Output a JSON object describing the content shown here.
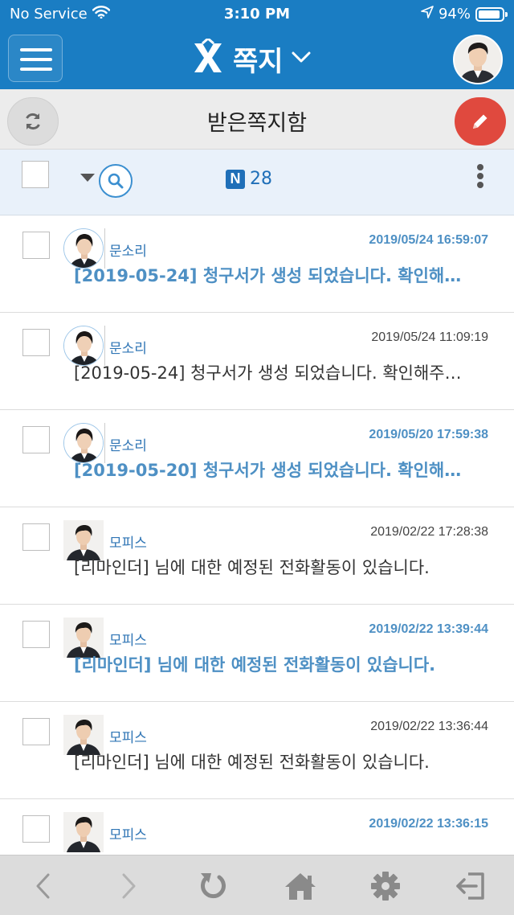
{
  "status_bar": {
    "carrier": "No Service",
    "time": "3:10 PM",
    "battery": "94%",
    "battery_level": 0.94
  },
  "header": {
    "title": "쪽지",
    "menu_icon": "hamburger-icon",
    "logo_icon": "app-logo-icon",
    "dropdown_icon": "chevron-down-icon",
    "profile_icon": "profile-avatar"
  },
  "subheader": {
    "title": "받은쪽지함",
    "refresh_icon": "refresh-icon",
    "compose_icon": "pencil-icon"
  },
  "toolbar": {
    "new_badge": "N",
    "count": "28",
    "search_icon": "search-icon",
    "more_icon": "kebab-menu-icon"
  },
  "messages": [
    {
      "sender": "문소리",
      "date": "2019/05/24 16:59:07",
      "subject": "[2019-05-24] 청구서가 생성 되었습니다. 확인해주세요.",
      "unread": true,
      "photo": "female"
    },
    {
      "sender": "문소리",
      "date": "2019/05/24 11:09:19",
      "subject": "[2019-05-24] 청구서가 생성 되었습니다. 확인해주세요.",
      "unread": false,
      "photo": "female"
    },
    {
      "sender": "문소리",
      "date": "2019/05/20 17:59:38",
      "subject": "[2019-05-20] 청구서가 생성 되었습니다. 확인해주세요.",
      "unread": true,
      "photo": "female"
    },
    {
      "sender": "모피스",
      "date": "2019/02/22 17:28:38",
      "subject": "[리마인더] 님에 대한 예정된 전화활동이 있습니다.",
      "unread": false,
      "photo": "male"
    },
    {
      "sender": "모피스",
      "date": "2019/02/22 13:39:44",
      "subject": "[리마인더] 님에 대한 예정된 전화활동이 있습니다.",
      "unread": true,
      "photo": "male"
    },
    {
      "sender": "모피스",
      "date": "2019/02/22 13:36:44",
      "subject": "[리마인더] 님에 대한 예정된 전화활동이 있습니다.",
      "unread": false,
      "photo": "male"
    },
    {
      "sender": "모피스",
      "date": "2019/02/22 13:36:15",
      "subject": "",
      "unread": true,
      "photo": "male"
    }
  ],
  "bottom_nav": {
    "items": [
      "back-icon",
      "forward-icon",
      "reload-icon",
      "home-icon",
      "settings-icon",
      "logout-icon"
    ]
  },
  "colors": {
    "brand_blue": "#1a7dc3",
    "unread_blue": "#4e90c4",
    "compose_red": "#e0493e"
  }
}
